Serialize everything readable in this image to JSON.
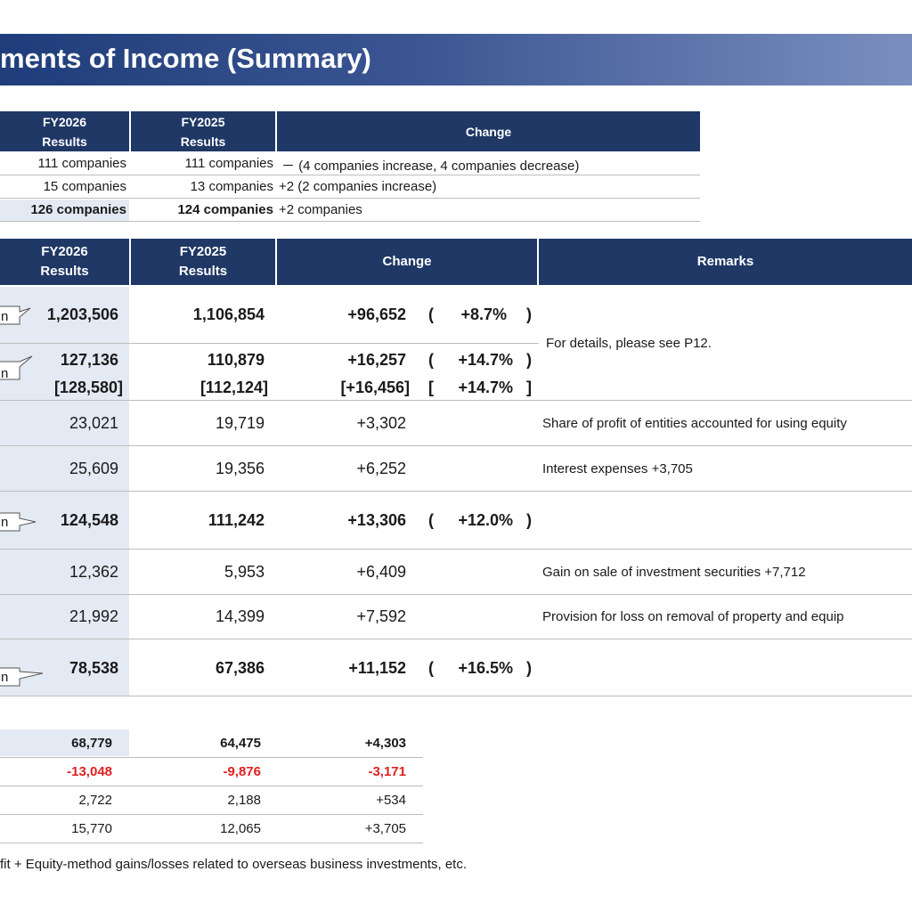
{
  "title": "ments of Income (Summary)",
  "companies": {
    "headers": {
      "fy2026": [
        "FY2026",
        "Results"
      ],
      "fy2025": [
        "FY2025",
        "Results"
      ],
      "change": "Change"
    },
    "rows": [
      {
        "fy2026": "111 companies",
        "fy2025": "111 companies",
        "change": "－ (4 companies increase, 4 companies decrease)"
      },
      {
        "fy2026": "15 companies",
        "fy2025": "13 companies",
        "change": "+2 (2 companies increase)"
      },
      {
        "fy2026": "126 companies",
        "fy2025": "124 companies",
        "change": "+2 companies"
      }
    ]
  },
  "income": {
    "headers": {
      "fy2026": [
        "FY2026",
        "Results"
      ],
      "fy2025": [
        "FY2025",
        "Results"
      ],
      "change": "Change",
      "remarks": "Remarks"
    },
    "callout_label": "n",
    "rows": [
      {
        "fy2026": "1,203,506",
        "fy2025": "1,106,854",
        "change": "+96,652",
        "pct": "+8.7%"
      },
      {
        "fy2026": "127,136",
        "fy2025": "110,879",
        "change": "+16,257",
        "pct": "+14.7%"
      },
      {
        "fy2026": "[128,580]",
        "fy2025": "[112,124]",
        "change": "[+16,456]",
        "pct": "+14.7%"
      },
      {
        "fy2026": "23,021",
        "fy2025": "19,719",
        "change": "+3,302",
        "remark": "Share of profit of entities accounted for using equity"
      },
      {
        "fy2026": "25,609",
        "fy2025": "19,356",
        "change": "+6,252",
        "remark": "Interest expenses +3,705"
      },
      {
        "fy2026": "124,548",
        "fy2025": "111,242",
        "change": "+13,306",
        "pct": "+12.0%"
      },
      {
        "fy2026": "12,362",
        "fy2025": "5,953",
        "change": "+6,409",
        "remark": "Gain on sale of investment securities +7,712"
      },
      {
        "fy2026": "21,992",
        "fy2025": "14,399",
        "change": "+7,592",
        "remark": "Provision for loss on removal of property and equip"
      },
      {
        "fy2026": "78,538",
        "fy2025": "67,386",
        "change": "+11,152",
        "pct": "+16.5%"
      }
    ],
    "details_remark": "For details, please see P12."
  },
  "bottom": {
    "rows": [
      {
        "fy2026": "68,779",
        "fy2025": "64,475",
        "change": "+4,303"
      },
      {
        "fy2026": "-13,048",
        "fy2025": "-9,876",
        "change": "-3,171"
      },
      {
        "fy2026": "2,722",
        "fy2025": "2,188",
        "change": "+534"
      },
      {
        "fy2026": "15,770",
        "fy2025": "12,065",
        "change": "+3,705"
      }
    ]
  },
  "footnote": "fit + Equity-method gains/losses related to overseas business investments, etc.",
  "colors": {
    "header": "#1f3866",
    "shade": "#e4eaf4",
    "negative": "#e02020"
  }
}
